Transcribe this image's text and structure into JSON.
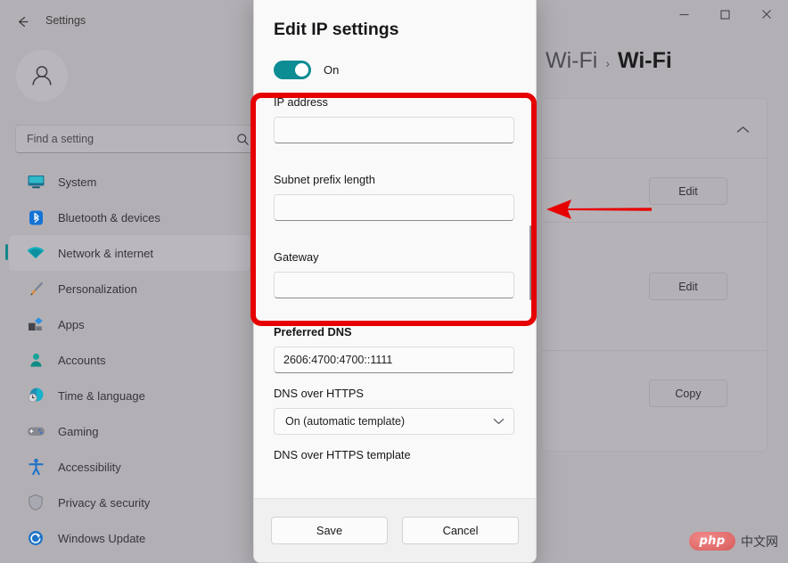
{
  "window": {
    "app_title": "Settings",
    "back_icon": "arrow-left-icon",
    "controls": {
      "minimize": "–",
      "maximize": "▢",
      "close": "✕"
    }
  },
  "sidebar": {
    "avatar_icon": "person-avatar-icon",
    "search": {
      "placeholder": "Find a setting",
      "icon": "search-icon"
    },
    "items": [
      {
        "label": "System",
        "icon": "monitor-icon",
        "active": false
      },
      {
        "label": "Bluetooth & devices",
        "icon": "bluetooth-icon",
        "active": false
      },
      {
        "label": "Network & internet",
        "icon": "wifi-icon",
        "active": true
      },
      {
        "label": "Personalization",
        "icon": "paintbrush-icon",
        "active": false
      },
      {
        "label": "Apps",
        "icon": "apps-icon",
        "active": false
      },
      {
        "label": "Accounts",
        "icon": "account-icon",
        "active": false
      },
      {
        "label": "Time & language",
        "icon": "clock-globe-icon",
        "active": false
      },
      {
        "label": "Gaming",
        "icon": "gamepad-icon",
        "active": false
      },
      {
        "label": "Accessibility",
        "icon": "accessibility-icon",
        "active": false
      },
      {
        "label": "Privacy & security",
        "icon": "shield-icon",
        "active": false
      },
      {
        "label": "Windows Update",
        "icon": "update-refresh-icon",
        "active": false
      }
    ]
  },
  "content": {
    "breadcrumb": {
      "parent": "Wi-Fi",
      "separator": "›",
      "current": "Wi-Fi"
    },
    "collapse_icon": "chevron-up-icon",
    "rows": [
      {
        "button": "Edit"
      },
      {
        "button": "Edit"
      },
      {
        "button": "Copy"
      }
    ],
    "watermark": {
      "logo_text": "php",
      "text": "中文网"
    }
  },
  "dialog": {
    "title": "Edit IP settings",
    "toggle": {
      "state_label": "On",
      "on": true,
      "accent": "#0c8c93"
    },
    "fields": [
      {
        "label": "IP address",
        "value": "",
        "type": "text",
        "bold": false
      },
      {
        "label": "Subnet prefix length",
        "value": "",
        "type": "text",
        "bold": false
      },
      {
        "label": "Gateway",
        "value": "",
        "type": "text",
        "bold": false
      },
      {
        "label": "Preferred DNS",
        "value": "2606:4700:4700::1111",
        "type": "text",
        "bold": true
      },
      {
        "label": "DNS over HTTPS",
        "value": "On (automatic template)",
        "type": "select",
        "bold": false
      },
      {
        "label": "DNS over HTTPS template",
        "value": "",
        "type": "text",
        "bold": false
      }
    ],
    "dropdown_icon": "chevron-down-icon",
    "scrollbar": "vertical-scrollbar",
    "footer": {
      "save_label": "Save",
      "cancel_label": "Cancel"
    }
  },
  "annotations": {
    "highlight_color": "#e60000",
    "rect_name": "red-highlight-rectangle",
    "arrow_name": "red-pointer-arrow"
  }
}
